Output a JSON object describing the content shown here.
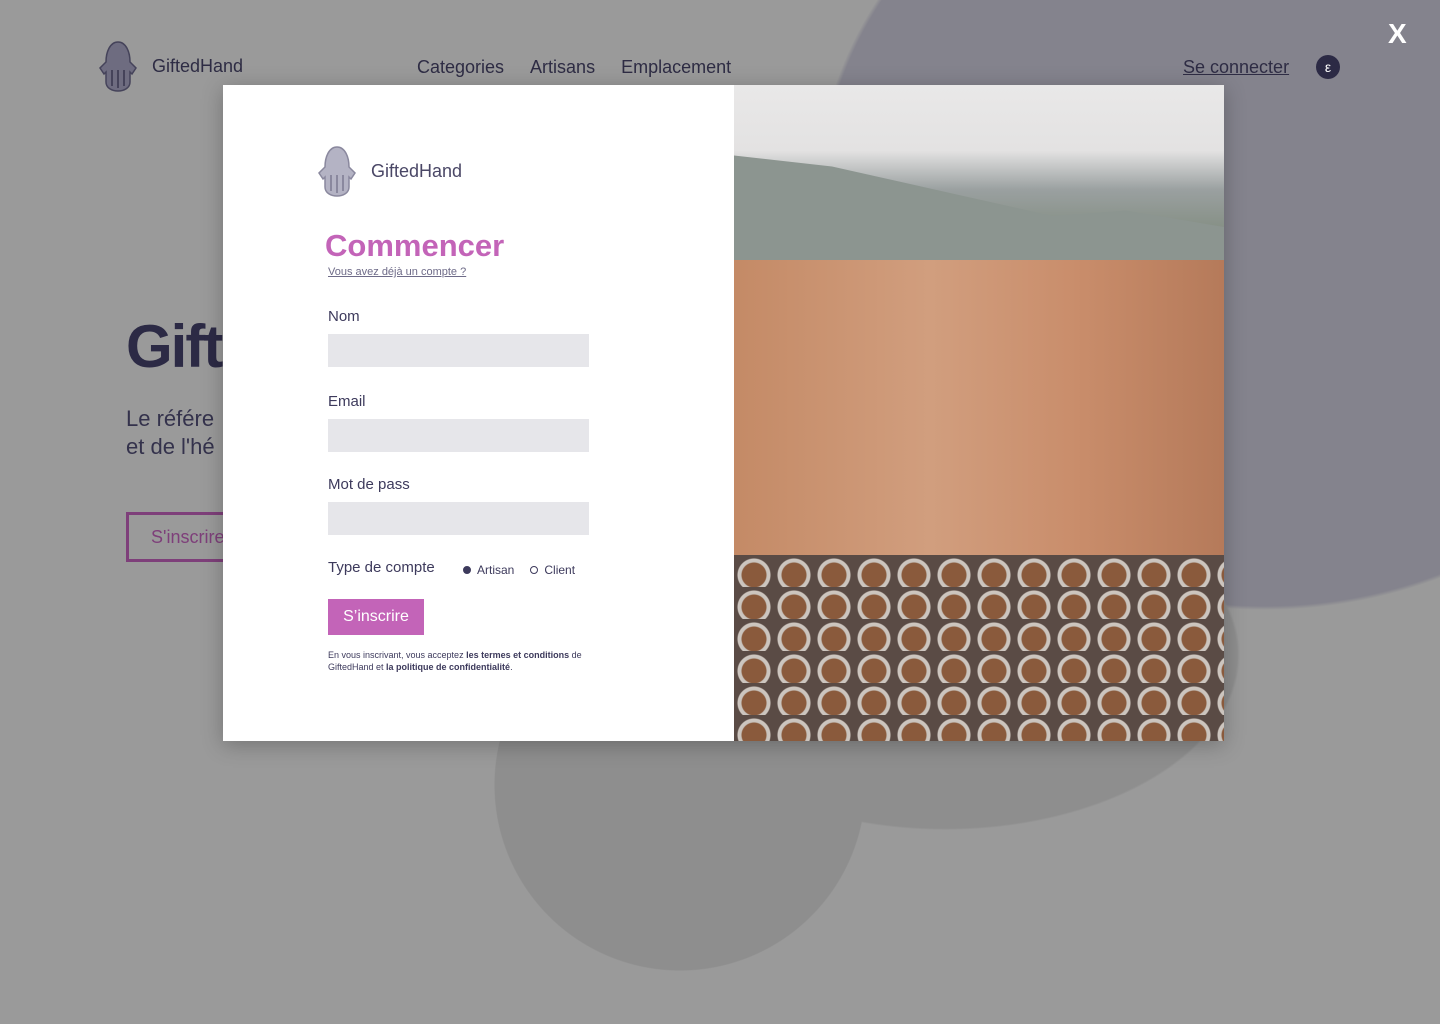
{
  "nav": {
    "brand": "GiftedHand",
    "links": [
      "Categories",
      "Artisans",
      "Emplacement"
    ],
    "login": "Se connecter",
    "avatar_letter": "ε"
  },
  "hero": {
    "title": "Gift",
    "subtitle_line1": "Le référe",
    "subtitle_line2": "et de l'hé",
    "button": "S'inscrire"
  },
  "modal": {
    "close": "X",
    "brand": "GiftedHand",
    "title": "Commencer",
    "have_account": "Vous avez déjà un compte ?",
    "fields": [
      {
        "label": "Nom",
        "value": ""
      },
      {
        "label": "Email",
        "value": ""
      },
      {
        "label": "Mot de pass",
        "value": ""
      }
    ],
    "account_type": {
      "label": "Type de compte",
      "options": [
        "Artisan",
        "Client"
      ],
      "selected": "Artisan"
    },
    "submit": "S’inscrire",
    "terms": {
      "pre": "En vous inscrivant, vous acceptez ",
      "link1": "les termes et conditions",
      "mid": " de GiftedHand et ",
      "link2": "la politique de confidentialité",
      "post": "."
    },
    "image_alt": "Fès tannery"
  },
  "colors": {
    "accent": "#c364b8",
    "text": "#3d3a5c",
    "overlay": "rgba(60,60,60,0.52)"
  }
}
